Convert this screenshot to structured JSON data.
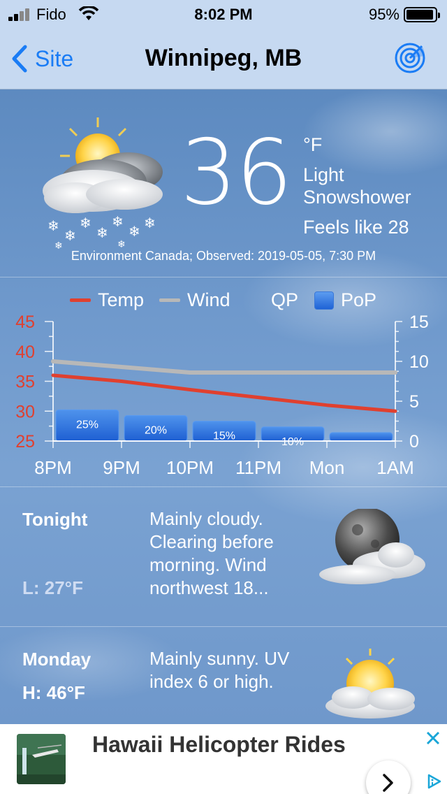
{
  "status_bar": {
    "carrier": "Fido",
    "time": "8:02 PM",
    "battery": "95%"
  },
  "nav": {
    "back_label": "Site",
    "title": "Winnipeg, MB",
    "radar_icon": "radar-icon"
  },
  "current": {
    "temperature": "36",
    "unit": "°F",
    "condition": "Light Snowshower",
    "feels_like": "Feels like 28",
    "observed": "Environment Canada; Observed: 2019-05-05, 7:30 PM",
    "icon": "sun-cloud-snow-icon"
  },
  "chart_legend": {
    "temp": "Temp",
    "wind": "Wind",
    "qp": "QP",
    "pop": "PoP"
  },
  "chart_data": {
    "type": "line",
    "x": [
      "8PM",
      "9PM",
      "10PM",
      "11PM",
      "Mon",
      "1AM"
    ],
    "left_axis": {
      "ticks": [
        "45",
        "40",
        "35",
        "30",
        "25"
      ],
      "range": [
        25,
        45
      ],
      "color": "#e0402f"
    },
    "right_axis": {
      "ticks": [
        "15",
        "10",
        "5",
        "0"
      ],
      "range": [
        0,
        15
      ]
    },
    "series": [
      {
        "name": "Temp",
        "axis": "left",
        "color": "#e0402f",
        "values": [
          36,
          35,
          33.6,
          32.3,
          31,
          30
        ]
      },
      {
        "name": "Wind",
        "axis": "right",
        "color": "#b8b8b8",
        "values": [
          10,
          9.3,
          8.6,
          8.6,
          8.6,
          8.6
        ]
      },
      {
        "name": "PoP",
        "type": "bar",
        "color": "#3d7fe0",
        "values": [
          25,
          20,
          15,
          10,
          5
        ],
        "labels": [
          "25%",
          "20%",
          "15%",
          "10%",
          ""
        ]
      }
    ]
  },
  "forecast": [
    {
      "day": "Tonight",
      "temp": "L: 27°F",
      "text": "Mainly cloudy. Clearing before morning. Wind northwest 18...",
      "icon": "moon-cloud-icon"
    },
    {
      "day": "Monday",
      "temp": "H: 46°F",
      "text": "Mainly sunny. UV index 6 or high.",
      "icon": "sun-cloud-icon"
    }
  ],
  "ad": {
    "title": "Hawaii Helicopter Rides",
    "close_icon": "close-icon",
    "adchoices_icon": "adchoices-icon"
  }
}
